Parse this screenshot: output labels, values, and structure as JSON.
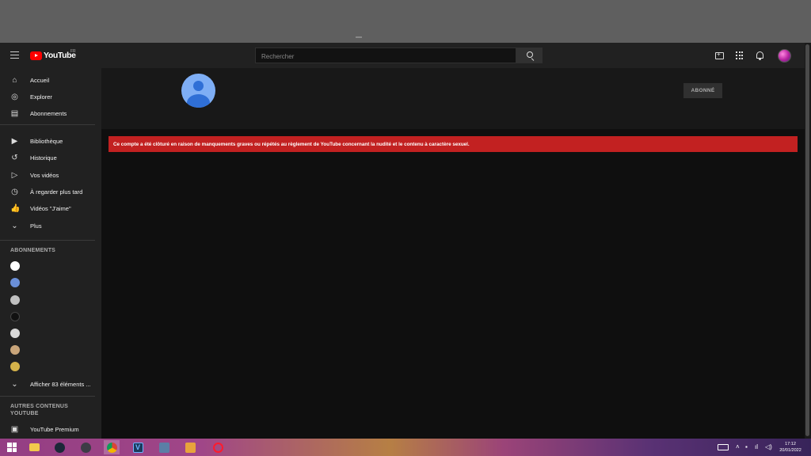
{
  "masthead": {
    "logo_text": "YouTube",
    "country_code": "FR",
    "search_placeholder": "Rechercher"
  },
  "sidebar": {
    "primary": [
      {
        "label": "Accueil",
        "icon": "home-icon"
      },
      {
        "label": "Explorer",
        "icon": "compass-icon"
      },
      {
        "label": "Abonnements",
        "icon": "subscriptions-icon"
      }
    ],
    "library": [
      {
        "label": "Bibliothèque",
        "icon": "library-icon"
      },
      {
        "label": "Historique",
        "icon": "history-icon"
      },
      {
        "label": "Vos vidéos",
        "icon": "your-videos-icon"
      },
      {
        "label": "À regarder plus tard",
        "icon": "watch-later-icon"
      },
      {
        "label": "Vidéos \"J'aime\"",
        "icon": "like-icon"
      },
      {
        "label": "Plus",
        "icon": "chevron-down-icon"
      }
    ],
    "subscriptions_title": "ABONNEMENTS",
    "subscription_colors": [
      "#ffffff",
      "#6a8fd8",
      "#c0c0c0",
      "#111111",
      "#d8d8d8",
      "#c9a57a",
      "#d4b24a"
    ],
    "show_more_label": "Afficher 83 éléments ...",
    "more_title": "AUTRES CONTENUS YOUTUBE",
    "premium_label": "YouTube Premium"
  },
  "channel": {
    "subscribed_label": "ABONNÉ"
  },
  "alert": {
    "message": "Ce compte a été clôturé en raison de manquements graves ou répétés au règlement de YouTube concernant la nudité et le contenu à caractère sexuel.",
    "color": "#c22121"
  },
  "taskbar": {
    "time": "17:12",
    "date": "20/01/2022"
  }
}
